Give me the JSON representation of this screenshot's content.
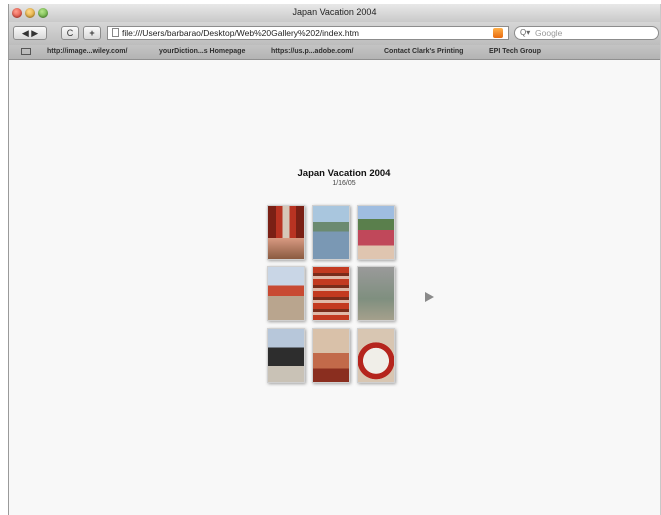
{
  "window": {
    "title": "Japan Vacation 2004"
  },
  "toolbar": {
    "nav_label": "◀ ▶",
    "reload_label": "C",
    "add_label": "+",
    "address_value": "file:///Users/barbarao/Desktop/Web%20Gallery%202/index.htm",
    "search_placeholder": "Google"
  },
  "bookmarks": [
    "http://image...wiley.com/",
    "yourDiction...s Homepage",
    "https://us.p...adobe.com/",
    "Contact Clark's Printing",
    "EPI Tech Group"
  ],
  "gallery": {
    "title": "Japan Vacation 2004",
    "date": "1/16/05"
  },
  "colors": {
    "background": "#f8f8f8",
    "arrow": "#8a8a8a"
  },
  "icons": {
    "close": "close-button-icon",
    "minimize": "minimize-button-icon",
    "zoom": "zoom-button-icon",
    "page": "page-icon",
    "rss": "rss-icon",
    "search": "search-icon",
    "bookmarks": "bookmarks-book-icon",
    "next": "next-arrow-icon"
  }
}
